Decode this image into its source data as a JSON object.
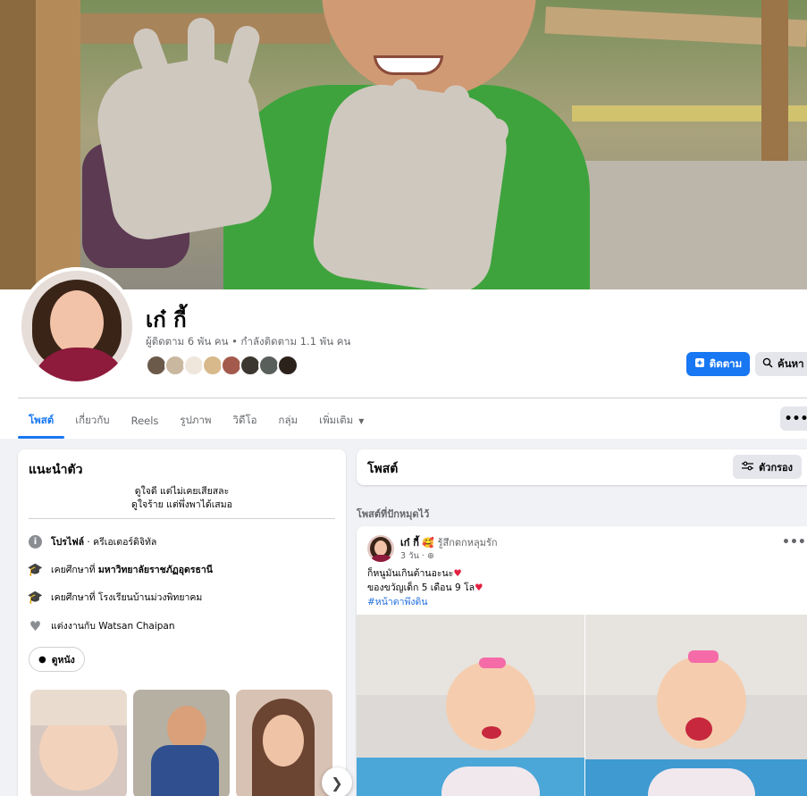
{
  "profile": {
    "name": "เก๋ กี้",
    "stats": "ผู้ติดตาม 6 พัน คน • กำลังติดตาม 1.1 พัน คน"
  },
  "actions": {
    "follow": "ติดตาม",
    "search": "ค้นหา",
    "more": "•••"
  },
  "tabs": [
    {
      "label": "โพสต์"
    },
    {
      "label": "เกี่ยวกับ"
    },
    {
      "label": "Reels"
    },
    {
      "label": "รูปภาพ"
    },
    {
      "label": "วิดีโอ"
    },
    {
      "label": "กลุ่ม"
    },
    {
      "label": "เพิ่มเติม"
    }
  ],
  "intro": {
    "title": "แนะนำตัว",
    "bio_line1": "ดูใจดี แต่ไม่เคยเสียสละ",
    "bio_line2": "ดูใจร้าย แต่พึ่งพาได้เสมอ",
    "profile_label": "โปรไฟล์",
    "profile_value": " · ครีเอเตอร์ดิจิทัล",
    "edu1_prefix": "เคยศึกษาที่ ",
    "edu1_school": "มหาวิทยาลัยราชภัฏอุดรธานี",
    "edu2": "เคยศึกษาที่ โรงเรียนบ้านม่วงพิทยาคม",
    "relationship": "แต่งงานกับ Watsan Chaipan",
    "hobby": "ดูหนัง"
  },
  "posts": {
    "title": "โพสต์",
    "filter": "ตัวกรอง",
    "pinned_label": "โพสต์ที่ปักหมุดไว้"
  },
  "post": {
    "author": "เก๋ กี้",
    "feeling": "รู้สึกตกหลุมรัก",
    "time": "3 วัน · ",
    "line1": "ก็หนูมันเกินต้านอะนะ",
    "line2": "ของขวัญเด็ก 5 เดือน 9 โล",
    "hashtag": "#หน้าตาพึงดิน"
  },
  "colors": {
    "accent": "#1877f2",
    "background": "#f0f2f5",
    "card": "#ffffff",
    "muted_text": "#65676b"
  },
  "icons": [
    "info-icon",
    "graduation-cap-icon",
    "heart-icon",
    "follow-icon",
    "search-icon",
    "filter-icon",
    "globe-icon",
    "chevron-right-icon"
  ]
}
